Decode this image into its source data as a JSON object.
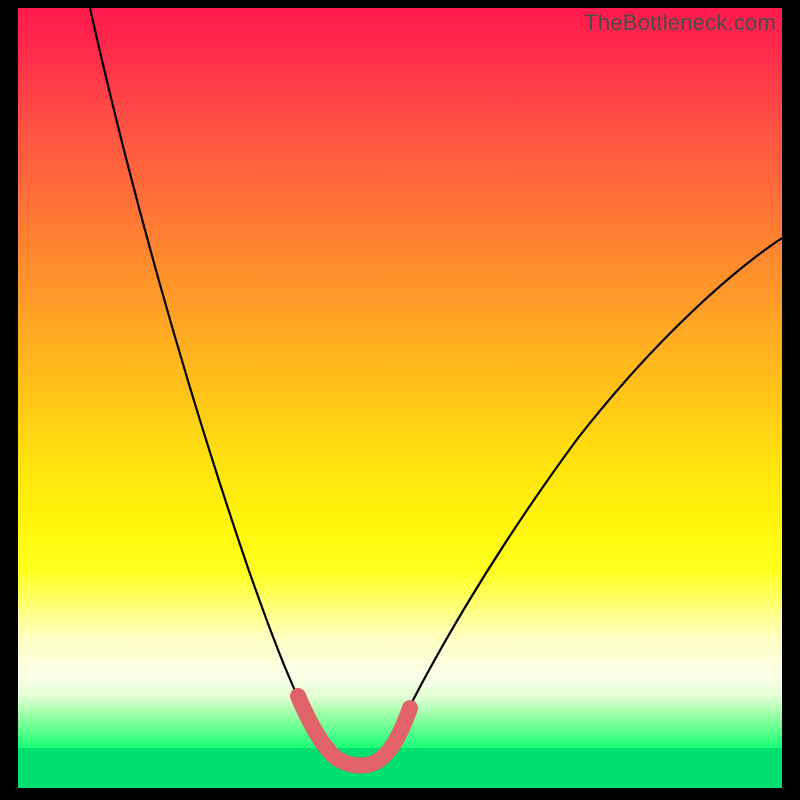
{
  "watermark": "TheBottleneck.com",
  "colors": {
    "background_black": "#000000",
    "curve_stroke": "#000000",
    "marker_stroke": "#e2626a",
    "bottom_green": "#00e06e"
  },
  "chart_data": {
    "type": "line",
    "title": "",
    "xlabel": "",
    "ylabel": "",
    "xlim": [
      0,
      100
    ],
    "ylim": [
      0,
      100
    ],
    "grid": false,
    "legend": false,
    "note": "Bottleneck-style curve: x is a normalized parameter (e.g., GPU-to-CPU balance), y is a normalized bottleneck percentage. Values are estimated from pixel positions; the figure has no numeric axis labels.",
    "series": [
      {
        "name": "left-branch",
        "x": [
          10,
          14,
          18,
          22,
          26,
          30,
          34,
          37,
          39
        ],
        "y": [
          100,
          82,
          66,
          51,
          37,
          25,
          14,
          7,
          4
        ]
      },
      {
        "name": "valley-floor",
        "x": [
          39,
          42,
          45,
          49
        ],
        "y": [
          4,
          2.5,
          2.5,
          4
        ]
      },
      {
        "name": "right-branch",
        "x": [
          49,
          53,
          58,
          64,
          71,
          79,
          88,
          96,
          100
        ],
        "y": [
          4,
          10,
          18,
          28,
          39,
          50,
          60,
          67,
          70
        ]
      }
    ],
    "markers": {
      "name": "valley-highlight",
      "note": "Thick salmon segment marking the optimal zone near the minimum.",
      "x": [
        36.5,
        37.5,
        38.5,
        39.5,
        40.5,
        41.5,
        42.5,
        43.5,
        44.5,
        45.5,
        46.5,
        47.5,
        48.5,
        49.5,
        50.5
      ],
      "y": [
        9,
        7,
        5.5,
        4.2,
        3.3,
        2.8,
        2.6,
        2.6,
        2.7,
        3.0,
        3.6,
        4.5,
        5.8,
        7.4,
        10
      ]
    }
  }
}
